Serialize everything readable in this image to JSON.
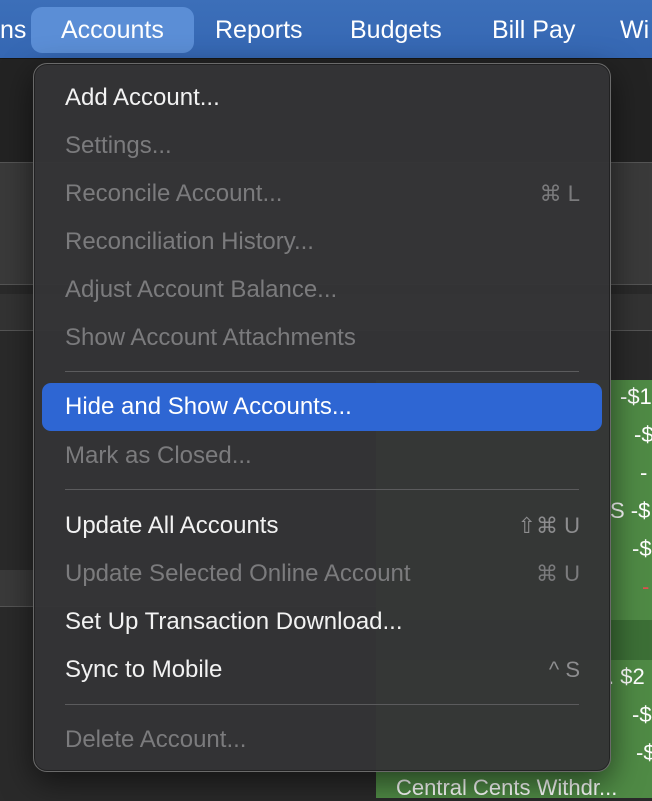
{
  "menubar": {
    "items": [
      {
        "label": "ns"
      },
      {
        "label": "Accounts"
      },
      {
        "label": "Reports"
      },
      {
        "label": "Budgets"
      },
      {
        "label": "Bill Pay"
      },
      {
        "label": "Wi"
      }
    ]
  },
  "background": {
    "right_values": [
      "-$1",
      "-$",
      "-",
      "S -$",
      "-$",
      "-",
      ". $2",
      "-$",
      "-$"
    ],
    "bottom_row": "Central Cents Withdr..."
  },
  "accounts_menu": {
    "items": [
      {
        "label": "Add Account...",
        "shortcut": "",
        "enabled": true
      },
      {
        "label": "Settings...",
        "shortcut": "",
        "enabled": false
      },
      {
        "label": "Reconcile Account...",
        "shortcut": "⌘ L",
        "enabled": false
      },
      {
        "label": "Reconciliation History...",
        "shortcut": "",
        "enabled": false
      },
      {
        "label": "Adjust Account Balance...",
        "shortcut": "",
        "enabled": false
      },
      {
        "label": "Show Account Attachments",
        "shortcut": "",
        "enabled": false
      },
      {
        "label": "Hide and Show Accounts...",
        "shortcut": "",
        "enabled": true,
        "highlighted": true
      },
      {
        "label": "Mark as Closed...",
        "shortcut": "",
        "enabled": false
      },
      {
        "label": "Update All Accounts",
        "shortcut": "⇧⌘ U",
        "enabled": true
      },
      {
        "label": "Update Selected Online Account",
        "shortcut": "⌘ U",
        "enabled": false
      },
      {
        "label": "Set Up Transaction Download...",
        "shortcut": "",
        "enabled": true
      },
      {
        "label": "Sync to Mobile",
        "shortcut": "^ S",
        "enabled": true
      },
      {
        "label": "Delete Account...",
        "shortcut": "",
        "enabled": false
      }
    ]
  },
  "colors": {
    "menubar": "#3567b3",
    "highlight": "#2e66d3",
    "menu_bg": "#343436",
    "green_cells": "#4f8a45"
  }
}
